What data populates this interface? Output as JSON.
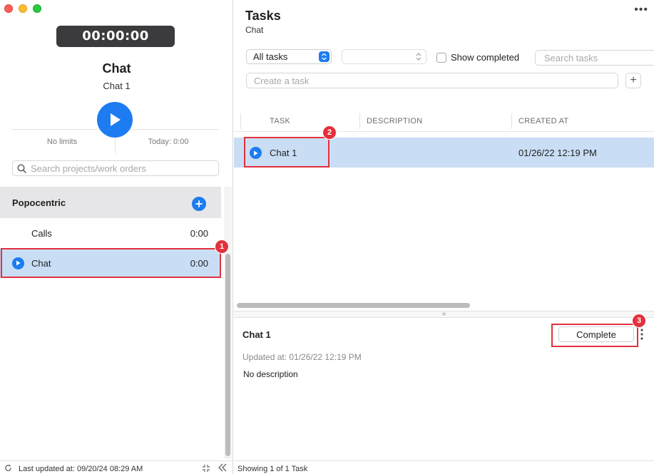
{
  "window": {
    "controls": [
      "close",
      "minimize",
      "zoom"
    ]
  },
  "sidebar": {
    "timer": "00:00:00",
    "project_title": "Chat",
    "task_subtitle": "Chat 1",
    "limits_text": "No limits",
    "today_text": "Today: 0:00",
    "search_placeholder": "Search projects/work orders",
    "group": {
      "name": "Popocentric"
    },
    "projects": [
      {
        "name": "Calls",
        "time": "0:00"
      },
      {
        "name": "Chat",
        "time": "0:00",
        "selected": true
      }
    ],
    "footer": {
      "last_updated": "Last updated at: 09/20/24 08:29 AM"
    }
  },
  "main": {
    "title": "Tasks",
    "subtitle": "Chat",
    "more_label": "•••",
    "filter": {
      "selected": "All tasks",
      "show_completed_label": "Show completed",
      "search_placeholder": "Search tasks"
    },
    "create_placeholder": "Create a task",
    "add_label": "+",
    "table": {
      "headers": {
        "task": "TASK",
        "description": "DESCRIPTION",
        "created_at": "CREATED AT"
      },
      "rows": [
        {
          "task": "Chat 1",
          "description": "",
          "created_at": "01/26/22 12:19 PM"
        }
      ]
    },
    "detail": {
      "title": "Chat 1",
      "complete_label": "Complete",
      "updated_at": "Updated at: 01/26/22 12:19 PM",
      "description": "No description"
    },
    "footer": {
      "showing": "Showing 1 of 1 Task"
    }
  },
  "annotations": {
    "badge1": "1",
    "badge2": "2",
    "badge3": "3"
  },
  "colors": {
    "accent": "#1d7cf2",
    "selection": "#c9def5",
    "highlight": "#e2313c",
    "timer_bg": "#3b3b3d"
  }
}
